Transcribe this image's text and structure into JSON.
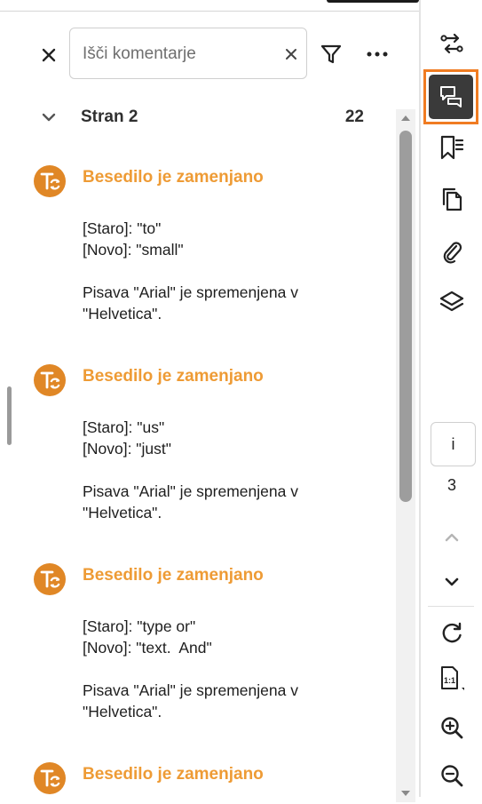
{
  "search": {
    "placeholder": "Išči komentarje",
    "value": ""
  },
  "toolbar": {
    "close_icon": "close-icon",
    "clear_icon": "clear-icon",
    "filter_icon": "filter-icon",
    "more_icon": "more-icon"
  },
  "section": {
    "title": "Stran 2",
    "count": "22",
    "icon": "chevron-down-icon"
  },
  "comments": [
    {
      "title": "Besedilo je zamenjano",
      "old": "[Staro]: \"to\"",
      "new": "[Novo]: \"small\"",
      "font_line1": "Pisava \"Arial\" je spremenjena v",
      "font_line2": "\"Helvetica\"."
    },
    {
      "title": "Besedilo je zamenjano",
      "old": "[Staro]: \"us\"",
      "new": "[Novo]: \"just\"",
      "font_line1": "Pisava \"Arial\" je spremenjena v",
      "font_line2": "\"Helvetica\"."
    },
    {
      "title": "Besedilo je zamenjano",
      "old": "[Staro]: \"type or\"",
      "new": "[Novo]: \"text.  And\"",
      "font_line1": "Pisava \"Arial\" je spremenjena v",
      "font_line2": "\"Helvetica\"."
    },
    {
      "title": "Besedilo je zamenjano"
    }
  ],
  "rail": {
    "tools": [
      "compare-icon",
      "comments-icon",
      "bookmarks-icon",
      "copy-pages-icon",
      "attachments-icon",
      "layers-icon"
    ],
    "page_input": "i",
    "page_total": "3",
    "nav": [
      "page-up-icon",
      "page-down-icon"
    ],
    "view": [
      "rotate-icon",
      "actual-size-icon",
      "zoom-in-icon",
      "zoom-out-icon"
    ]
  },
  "colors": {
    "accent_orange": "#ee9b35",
    "avatar_orange": "#e08726",
    "active_outline": "#f07c22",
    "active_fill": "#3a3a3a"
  }
}
